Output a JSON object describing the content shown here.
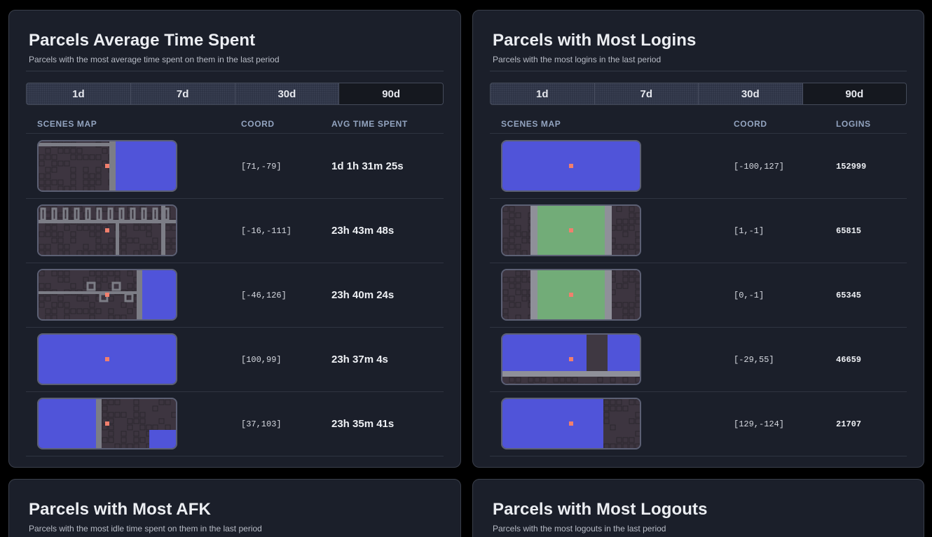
{
  "tabs": [
    "1d",
    "7d",
    "30d",
    "90d"
  ],
  "active_tab": "90d",
  "colors": {
    "blue": "#5054d9",
    "green": "#72ac78",
    "marker": "#f17f6d",
    "road": "#7c7d86",
    "ground": "#3d3540"
  },
  "cards": [
    {
      "title": "Parcels Average Time Spent",
      "subtitle": "Parcels with the most average time spent on them in the last period",
      "headers": {
        "map": "SCENES MAP",
        "coord": "COORD",
        "metric": "AVG TIME SPENT"
      },
      "rows": [
        {
          "coord": "[71,-79]",
          "value": "1d 1h 31m 25s",
          "map": "blue-right"
        },
        {
          "coord": "[-16,-111]",
          "value": "23h 43m 48s",
          "map": "city-grid"
        },
        {
          "coord": "[-46,126]",
          "value": "23h 40m 24s",
          "map": "city-blue-edge"
        },
        {
          "coord": "[100,99]",
          "value": "23h 37m 4s",
          "map": "all-blue"
        },
        {
          "coord": "[37,103]",
          "value": "23h 35m 41s",
          "map": "blue-left"
        }
      ]
    },
    {
      "title": "Parcels with Most Logins",
      "subtitle": "Parcels with the most logins in the last period",
      "headers": {
        "map": "SCENES MAP",
        "coord": "COORD",
        "metric": "LOGINS"
      },
      "rows": [
        {
          "coord": "[-100,127]",
          "value": "152999",
          "map": "all-blue"
        },
        {
          "coord": "[1,-1]",
          "value": "65815",
          "map": "green-plaza"
        },
        {
          "coord": "[0,-1]",
          "value": "65345",
          "map": "green-plaza"
        },
        {
          "coord": "[-29,55]",
          "value": "46659",
          "map": "blue-road"
        },
        {
          "coord": "[129,-124]",
          "value": "21707",
          "map": "blue-left-wide"
        }
      ]
    },
    {
      "title": "Parcels with Most AFK",
      "subtitle": "Parcels with the most idle time spent on them in the last period"
    },
    {
      "title": "Parcels with Most Logouts",
      "subtitle": "Parcels with the most logouts in the last period"
    }
  ]
}
